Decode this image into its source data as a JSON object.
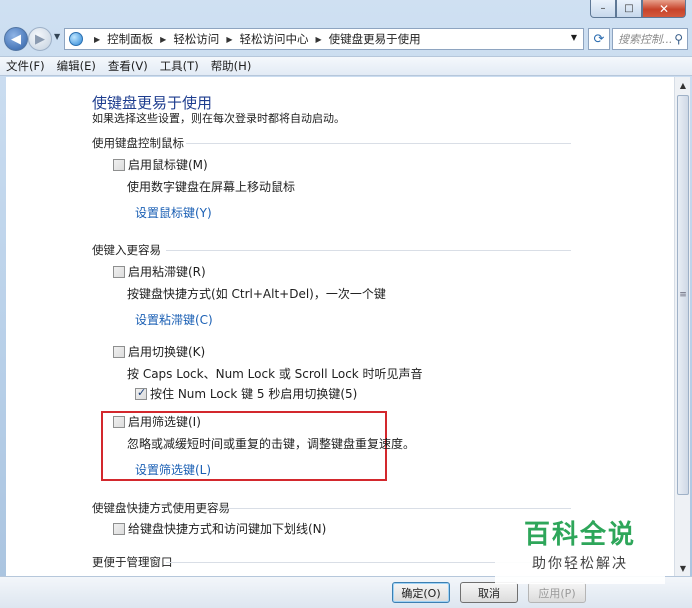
{
  "titlebar": {
    "min": "–",
    "max": "□",
    "close": "✕"
  },
  "nav": {
    "crumbs": [
      "控制面板",
      "轻松访问",
      "轻松访问中心",
      "使键盘更易于使用"
    ],
    "search_placeholder": "搜索控制..."
  },
  "menu": [
    "文件(F)",
    "编辑(E)",
    "查看(V)",
    "工具(T)",
    "帮助(H)"
  ],
  "page": {
    "title": "使键盘更易于使用",
    "subtitle": "如果选择这些设置，则在每次登录时都将自动启动。"
  },
  "sections": {
    "mouse": {
      "heading": "使用键盘控制鼠标",
      "checkbox": "启用鼠标键(M)",
      "desc": "使用数字键盘在屏幕上移动鼠标",
      "link": "设置鼠标键(Y)"
    },
    "typing": {
      "heading": "使键入更容易",
      "sticky_checkbox": "启用粘滞键(R)",
      "sticky_desc": "按键盘快捷方式(如 Ctrl+Alt+Del)，一次一个键",
      "sticky_link": "设置粘滞键(C)",
      "toggle_checkbox": "启用切换键(K)",
      "toggle_desc": "按 Caps Lock、Num Lock 或 Scroll Lock 时听见声音",
      "toggle_sub_checkbox": "按住 Num Lock 键 5 秒启用切换键(5)",
      "filter_checkbox": "启用筛选键(I)",
      "filter_desc": "忽略或减缓短时间或重复的击键，调整键盘重复速度。",
      "filter_link": "设置筛选键(L)"
    },
    "shortcuts": {
      "heading": "使键盘快捷方式使用更容易",
      "checkbox": "给键盘快捷方式和访问键加下划线(N)"
    },
    "window": {
      "heading": "更便于管理窗口"
    }
  },
  "buttons": {
    "ok": "确定(O)",
    "cancel": "取消",
    "apply": "应用(P)"
  },
  "watermark": {
    "big": "百科全说",
    "small": "助你轻松解决"
  }
}
